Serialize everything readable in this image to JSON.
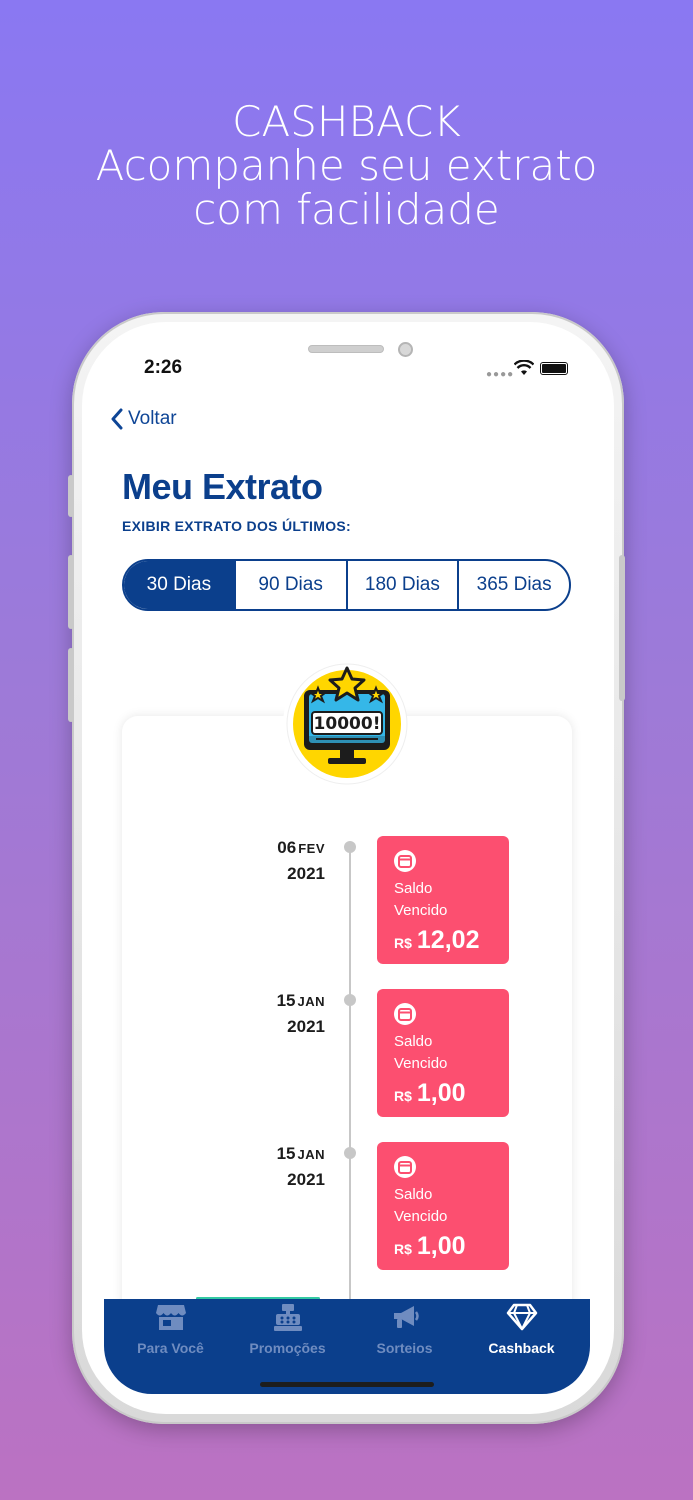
{
  "headline": [
    "CASHBACK",
    "Acompanhe seu extrato",
    "com facilidade"
  ],
  "status_bar": {
    "time": "2:26"
  },
  "nav": {
    "back_label": "Voltar"
  },
  "page": {
    "title": "Meu Extrato",
    "subtitle": "EXIBIR EXTRATO DOS ÚLTIMOS:"
  },
  "period_filter": {
    "options": [
      "30 Dias",
      "90 Dias",
      "180 Dias",
      "365 Dias"
    ],
    "selected": "30 Dias"
  },
  "badge": {
    "text": "10000!"
  },
  "transactions": [
    {
      "day": "06",
      "month": "FEV",
      "year": "2021",
      "label_line1": "Saldo",
      "label_line2": "Vencido",
      "currency": "R$",
      "amount": "12,02"
    },
    {
      "day": "15",
      "month": "JAN",
      "year": "2021",
      "label_line1": "Saldo",
      "label_line2": "Vencido",
      "currency": "R$",
      "amount": "1,00"
    },
    {
      "day": "15",
      "month": "JAN",
      "year": "2021",
      "label_line1": "Saldo",
      "label_line2": "Vencido",
      "currency": "R$",
      "amount": "1,00"
    }
  ],
  "tabbar": {
    "items": [
      {
        "label": "Para Você",
        "icon": "store-icon"
      },
      {
        "label": "Promoções",
        "icon": "cash-register-icon"
      },
      {
        "label": "Sorteios",
        "icon": "megaphone-icon"
      },
      {
        "label": "Cashback",
        "icon": "diamond-icon"
      }
    ],
    "active": "Cashback"
  },
  "colors": {
    "primary": "#0b3f8c",
    "transaction": "#fc4f70",
    "badge_bg": "#ffd600",
    "background_top": "#8a78f2",
    "background_bottom": "#bb72c2"
  }
}
